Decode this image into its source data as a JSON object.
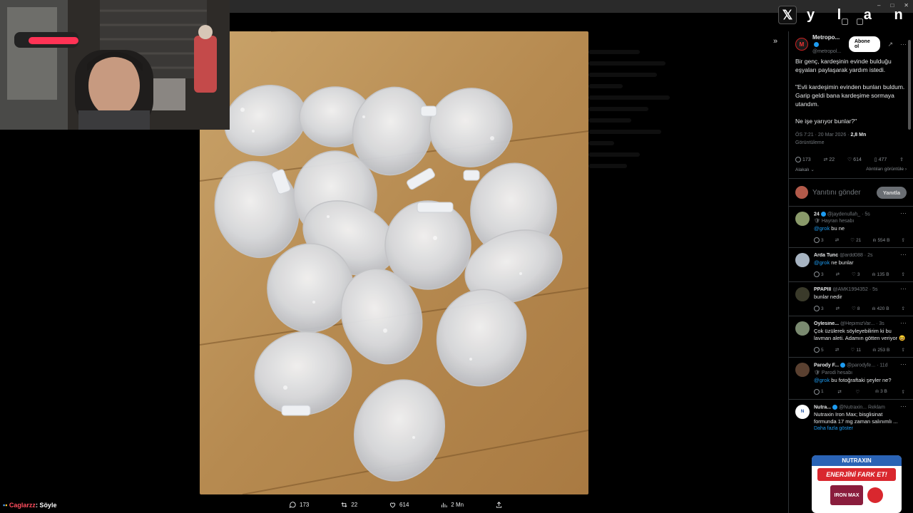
{
  "overlay": {
    "logo_letters": "y l a n",
    "chat_user": "Caglarzz",
    "chat_message": ": Söyle"
  },
  "icons": {
    "x_logo": "x-logo-icon",
    "collapse": "chevron-double-right-icon"
  },
  "colors": {
    "accent": "#1d9bf0",
    "chat_name": "#ff4d5e",
    "background": "#000000"
  },
  "media_actions": {
    "replies": "173",
    "retweets": "22",
    "likes": "614",
    "views": "2 Mn"
  },
  "post": {
    "author_name": "Metropo...",
    "author_handle": "@metropol...",
    "follow_label": "Abone ol",
    "paragraphs": [
      "Bir genç, kardeşinin evinde bulduğu eşyaları paylaşarak yardım istedi.",
      "\"Evli kardeşimin evinden bunları buldum. Garip geldi bana kardeşime sormaya utandım.",
      "Ne işe yarıyor bunlar?\""
    ],
    "timestamp": "ÖS 7:21 · 20 Mar 2026 ·",
    "views_count": "2,8 Mn",
    "views_label": "Görüntüleme",
    "stats": {
      "replies": "173",
      "retweets": "22",
      "likes": "614",
      "bookmarks": "477"
    },
    "sort_label": "Alakalı",
    "quotes_label": "Alıntıları görüntüle"
  },
  "reply_box": {
    "placeholder": "Yanıtını gönder",
    "button": "Yanıtla"
  },
  "replies": [
    {
      "name": "24",
      "handle": "@jaydenullah_ · 5s",
      "badge": "Hayran hesabı",
      "mention": "@grok",
      "text": " bu ne",
      "replies": "3",
      "likes": "21",
      "views": "554 B",
      "avatar": "#8a9a6a"
    },
    {
      "name": "Arda Tunc",
      "handle": "@ardd088 · 2s",
      "badge": "",
      "mention": "@grok",
      "text": " ne bunlar",
      "replies": "3",
      "likes": "3",
      "views": "135 B",
      "avatar": "#a7b4c2"
    },
    {
      "name": "PPAPIII",
      "handle": "@AMK1994352 · 5s",
      "badge": "",
      "mention": "",
      "text": "bunlar nedir",
      "replies": "3",
      "likes": "8",
      "views": "420 B",
      "avatar": "#3a3a2a"
    },
    {
      "name": "Öylesine...",
      "handle": "@HepimizVar... · 3s",
      "badge": "",
      "mention": "",
      "text": "Çok üzülerek söyleyebilirim ki bu lavman aleti. Adamın götten veriyor 😆",
      "replies": "5",
      "likes": "11",
      "views": "253 B",
      "avatar": "#7a8a70"
    },
    {
      "name": "Parody F...",
      "handle": "@parodyfe... · 11d",
      "badge": "Parodi hesabı",
      "mention": "@grok",
      "text": " bu fotoğraftaki şeyler ne?",
      "replies": "1",
      "likes": "",
      "views": "3 B",
      "avatar": "#5a4030"
    }
  ],
  "ad": {
    "name": "Nutra...",
    "handle": "@Nutraxin...",
    "label": "Reklam",
    "text": "Nutraxin Iron Max; bisglisinat formunda 17 mg zaman salınımlı ...",
    "more": "Daha fazla göster",
    "banner_brand": "NUTRAXIN",
    "banner_slogan": "ENERJİNİ FARK ET!",
    "banner_product": "IRON MAX"
  }
}
